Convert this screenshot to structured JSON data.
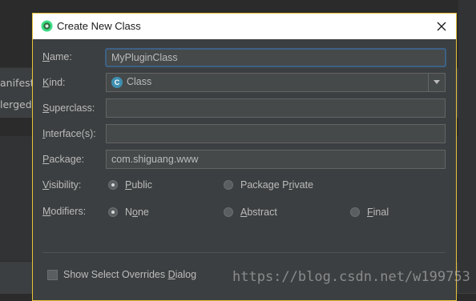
{
  "background_ide": {
    "tab_manifest": "anifest",
    "tab_merged": "lerged"
  },
  "dialog": {
    "title": "Create New Class",
    "close_icon": "close-icon",
    "fields": {
      "name": {
        "label_prefix": "",
        "label_mnemonic": "N",
        "label_rest": "ame:",
        "value": "MyPluginClass"
      },
      "kind": {
        "label_mnemonic": "K",
        "label_rest": "ind:",
        "value": "Class",
        "icon_letter": "C"
      },
      "superclass": {
        "label_mnemonic": "S",
        "label_rest": "uperclass:",
        "value": ""
      },
      "interfaces": {
        "label_mnemonic": "I",
        "label_rest": "nterface(s):",
        "value": ""
      },
      "package": {
        "label_prefix": "",
        "label_mnemonic": "P",
        "label_rest": "ackage:",
        "value": "com.shiguang.www"
      }
    },
    "visibility": {
      "label_mnemonic": "V",
      "label_rest": "isibility:",
      "options": [
        {
          "mnemonic": "P",
          "rest": "ublic",
          "selected": true
        },
        {
          "pre": "Package P",
          "mnemonic": "r",
          "rest": "ivate",
          "selected": false
        }
      ]
    },
    "modifiers": {
      "label_mnemonic": "M",
      "label_rest": "odifiers:",
      "options": [
        {
          "pre": "N",
          "mnemonic": "o",
          "rest": "ne",
          "selected": true
        },
        {
          "pre": "",
          "mnemonic": "A",
          "rest": "bstract",
          "selected": false
        },
        {
          "pre": "",
          "mnemonic": "F",
          "rest": "inal",
          "selected": false
        }
      ]
    },
    "overrides_checkbox": {
      "pre": "Show Select Overrides ",
      "mnemonic": "D",
      "rest": "ialog",
      "checked": false
    }
  },
  "watermark": "https://blog.csdn.net/w199753",
  "colors": {
    "dialog_bg": "#3c3f41",
    "focus_border": "#3d6185",
    "title_bg": "#ffffff",
    "dialog_outline": "#e8c33a",
    "class_icon": "#3e8fb0"
  }
}
